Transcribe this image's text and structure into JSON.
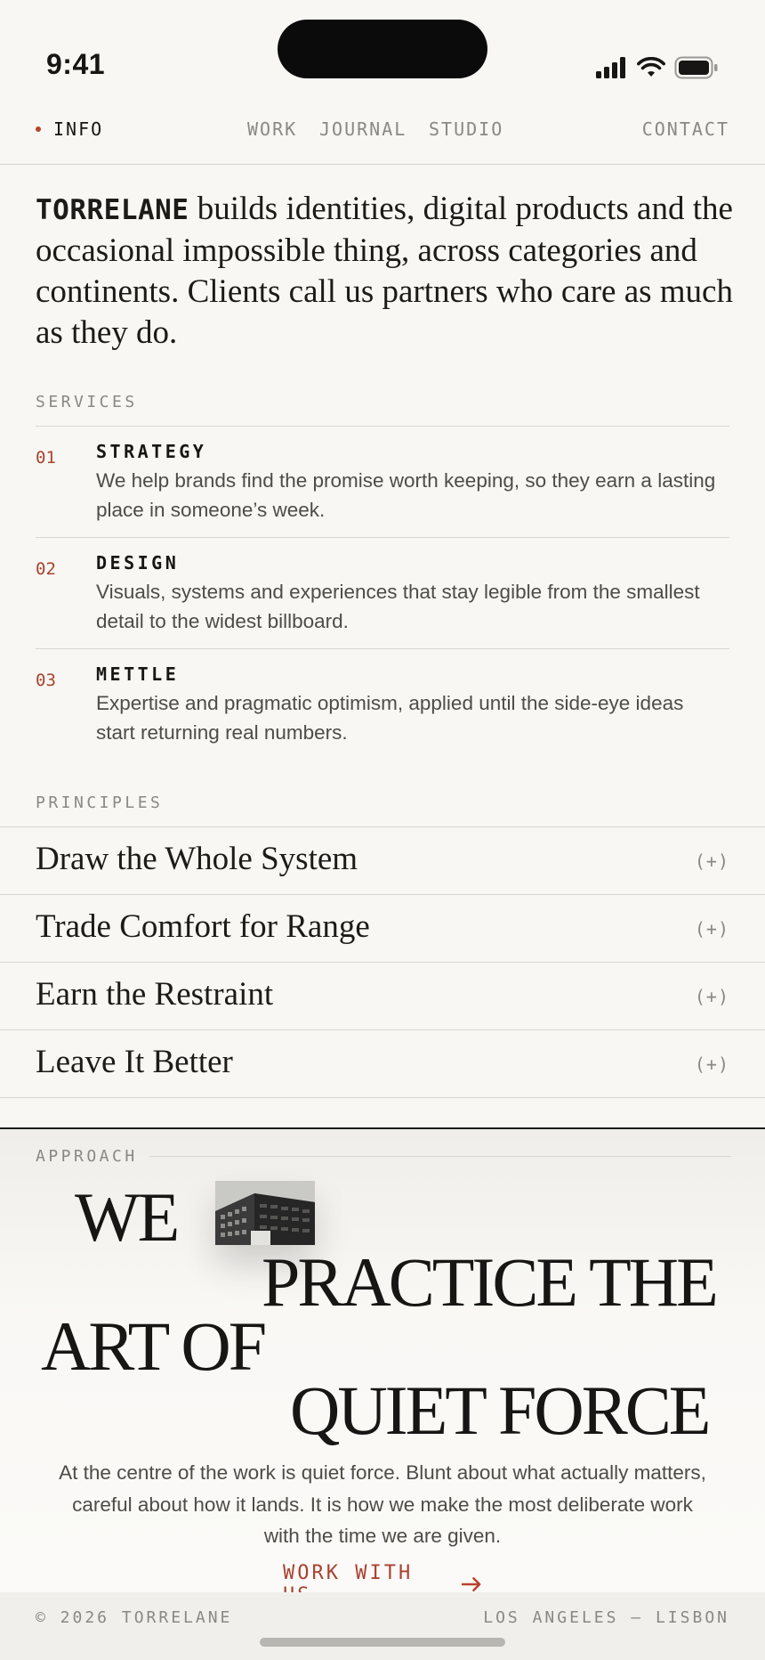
{
  "status_bar": {
    "time": "9:41"
  },
  "nav": {
    "info": "INFO",
    "items": [
      "WORK",
      "JOURNAL",
      "STUDIO"
    ],
    "contact": "CONTACT",
    "accent": "#b9422d"
  },
  "intro": {
    "brand": "TORRELANE",
    "text": " builds identities, digital products and the occasional impossible thing, across categories and continents. Clients call us partners who care as much as they do."
  },
  "services": {
    "label": "SERVICES",
    "items": [
      {
        "num": "01",
        "title": "STRATEGY",
        "desc": "We help brands find the promise worth keeping, so they earn a lasting place in someone’s week."
      },
      {
        "num": "02",
        "title": "DESIGN",
        "desc": "Visuals, systems and experiences that stay legible from the smallest detail to the widest billboard."
      },
      {
        "num": "03",
        "title": "METTLE",
        "desc": "Expertise and pragmatic optimism, applied until the side-eye ideas start returning real numbers."
      }
    ]
  },
  "principles": {
    "label": "PRINCIPLES",
    "toggle": "(+)",
    "items": [
      "Draw the Whole System",
      "Trade Comfort for Range",
      "Earn the Restraint",
      "Leave It Better"
    ]
  },
  "approach": {
    "label": "APPROACH",
    "line1": "WE",
    "line2": "PRACTICE THE",
    "line3": "ART OF",
    "line4": "QUIET FORCE",
    "body": "At the centre of the work is quiet force. Blunt about what actually matters, careful about how it lands. It is how we make the most deliberate work with the time we are given.",
    "cta": "WORK WITH US"
  },
  "footer": {
    "copyright": "© 2026 TORRELANE",
    "locations": "LOS ANGELES — LISBON"
  }
}
